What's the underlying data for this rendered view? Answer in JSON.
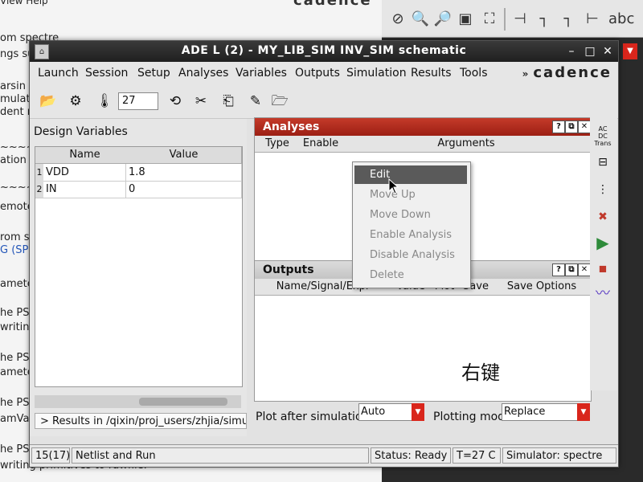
{
  "background": {
    "log_menu": "View  Help",
    "log_lines": [
      "om spectre",
      "ngs su",
      "arsin",
      "mulat",
      "dent m",
      "~~~~",
      "ation S",
      "~~~~",
      "emote",
      "rom sp",
      "G (SP",
      "amete",
      "he PS",
      "writing",
      "he PS",
      "amete",
      "he PS",
      "amVa",
      "he PS",
      "writing primitives to rawfile."
    ],
    "cadence_label": "cadence"
  },
  "window": {
    "title": "ADE L (2) - MY_LIB_SIM INV_SIM schematic"
  },
  "menu": [
    "Launch",
    "Session",
    "Setup",
    "Analyses",
    "Variables",
    "Outputs",
    "Simulation",
    "Results",
    "Tools"
  ],
  "logo": "cadence",
  "toolbar": {
    "temperature": "27",
    "temp_unit": "°C"
  },
  "design_variables": {
    "title": "Design Variables",
    "columns": [
      "Name",
      "Value"
    ],
    "rows": [
      {
        "num": "1",
        "name": "VDD",
        "value": "1.8"
      },
      {
        "num": "2",
        "name": "IN",
        "value": "0"
      }
    ],
    "results_path": "> Results in /qixin/proj_users/zhjia/simu"
  },
  "analyses": {
    "title": "Analyses",
    "columns": [
      "Type",
      "Enable",
      "Arguments"
    ]
  },
  "outputs": {
    "title": "Outputs",
    "columns": [
      "Name/Signal/Expr",
      "Value",
      "Plot",
      "Save",
      "Save Options"
    ]
  },
  "context_menu": {
    "items": [
      "Edit",
      "Move Up",
      "Move Down",
      "Enable Analysis",
      "Disable Analysis",
      "Delete"
    ],
    "active": "Edit"
  },
  "annotation": {
    "text": "右键",
    "color": "#f07a2a"
  },
  "plot_controls": {
    "plot_after_label": "Plot after simulation",
    "plot_after_value": "Auto",
    "plotting_mode_label": "Plotting mode",
    "plotting_mode_value": "Replace"
  },
  "status": {
    "count": "15(17)",
    "action": "Netlist and Run",
    "status": "Status: Ready",
    "temp": "T=27 C",
    "simulator": "Simulator: spectre"
  },
  "colors": {
    "accent_red": "#b8281b",
    "titlebar": "#2a2a2a"
  }
}
